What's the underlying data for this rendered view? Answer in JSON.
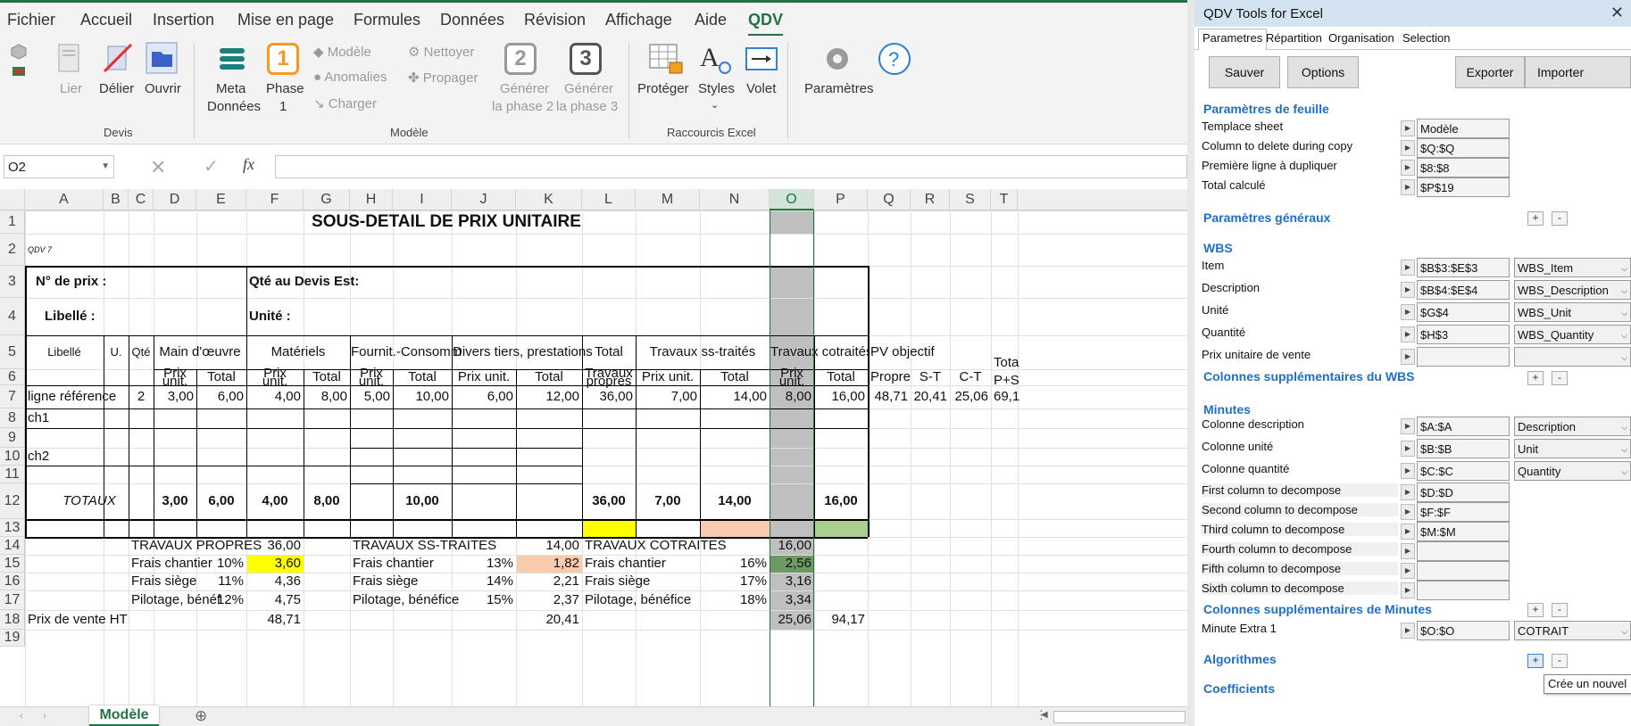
{
  "ribbon": {
    "tabs": [
      "Fichier",
      "Accueil",
      "Insertion",
      "Mise en page",
      "Formules",
      "Données",
      "Révision",
      "Affichage",
      "Aide",
      "QDV"
    ],
    "active_tab": "QDV",
    "groups": {
      "devis": "Devis",
      "modele": "Modèle",
      "raccourcis": "Raccourcis Excel"
    },
    "buttons": {
      "lier": "Lier",
      "delier": "Délier",
      "ouvrir": "Ouvrir",
      "meta1": "Meta",
      "meta2": "Données",
      "phase_l1": "Phase",
      "phase_l2": "1",
      "phase_num": "1",
      "modele": "Modèle",
      "anomalies": "Anomalies",
      "charger": "Charger",
      "nettoyer": "Nettoyer",
      "propager": "Propager",
      "gen2_num": "2",
      "gen2_l1": "Générer",
      "gen2_l2": "la phase 2",
      "gen3_num": "3",
      "gen3_l1": "Générer",
      "gen3_l2": "la phase 3",
      "proteger": "Protéger",
      "styles": "Styles",
      "volet": "Volet",
      "parametres": "Paramètres"
    }
  },
  "formula_bar": {
    "name_box": "O2",
    "formula": ""
  },
  "columns": [
    "A",
    "B",
    "C",
    "D",
    "E",
    "F",
    "G",
    "H",
    "I",
    "J",
    "K",
    "L",
    "M",
    "N",
    "O",
    "P",
    "Q",
    "R",
    "S",
    "T"
  ],
  "selected_column": "O",
  "rows": [
    "1",
    "2",
    "3",
    "4",
    "5",
    "6",
    "7",
    "8",
    "9",
    "10",
    "11",
    "12",
    "13",
    "14",
    "15",
    "16",
    "17",
    "18",
    "19"
  ],
  "sheet": {
    "title": "SOUS-DETAIL DE PRIX UNITAIRE",
    "qdv_tag": "QDV 7",
    "no_prix": "N° de prix :",
    "qte_devis": "Qté au Devis Est:",
    "libelle": "Libellé :",
    "unite_hdr": "Unité :",
    "h_main": "Main d'œuvre",
    "h_materiels": "Matériels",
    "h_fournit": "Fournit.-Consomm",
    "h_divers": "Divers tiers, prestations",
    "h_total_tp_1": "Total",
    "h_total_tp_2": "Travaux",
    "h_total_tp_3": "propres",
    "h_travaux_sst": "Travaux ss-traités",
    "h_travaux_cot": "Travaux cotraités",
    "h_pv": "PV objectif",
    "h_libelle": "Libellé",
    "h_u": "U.",
    "h_qte": "Qté",
    "h_prix": "Prix",
    "h_unit": "unit.",
    "h_total": "Total",
    "h_prix_unit": "Prix unit.",
    "h_propre": "Propre",
    "h_st": "S-T",
    "h_ct": "C-T",
    "h_tota": "Tota",
    "h_ps": "P+S",
    "r8": {
      "label": "ligne référence",
      "qte": "2",
      "d": "3,00",
      "e": "6,00",
      "f": "4,00",
      "g": "8,00",
      "h": "5,00",
      "i": "10,00",
      "j": "6,00",
      "k": "12,00",
      "l": "36,00",
      "m": "7,00",
      "n": "14,00",
      "o": "8,00",
      "p": "16,00",
      "q": "48,71",
      "r": "20,41",
      "s": "25,06",
      "t": "69,1"
    },
    "r9": "ch1",
    "r11": "ch2",
    "r13": {
      "label": "TOTAUX",
      "d": "3,00",
      "e": "6,00",
      "f": "4,00",
      "g": "8,00",
      "i": "10,00",
      "l": "36,00",
      "m": "7,00",
      "n": "14,00",
      "p": "16,00"
    },
    "recap": {
      "tp": "TRAVAUX PROPRES",
      "tp_val": "36,00",
      "sst": "TRAVAUX SS-TRAITES",
      "sst_val": "14,00",
      "cot": "TRAVAUX COTRAITES",
      "cot_val": "16,00",
      "fc": "Frais chantier",
      "fs": "Frais siège",
      "pb": "Pilotage, bénéf",
      "pb2": "Pilotage, bénéfice",
      "tp_fc_pct": "10%",
      "tp_fc": "3,60",
      "tp_fs_pct": "11%",
      "tp_fs": "4,36",
      "tp_pb_pct": "12%",
      "tp_pb": "4,75",
      "sst_fc_pct": "13%",
      "sst_fc": "1,82",
      "sst_fs_pct": "14%",
      "sst_fs": "2,21",
      "sst_pb_pct": "15%",
      "sst_pb": "2,37",
      "cot_fc_pct": "16%",
      "cot_fc": "2,56",
      "cot_fs_pct": "17%",
      "cot_fs": "3,16",
      "cot_pb_pct": "18%",
      "cot_pb": "3,34",
      "pv_ht": "Prix de vente HT",
      "pv_tp": "48,71",
      "pv_sst": "20,41",
      "pv_cot": "25,06",
      "pv_total": "94,17"
    },
    "tab_name": "Modèle"
  },
  "panel": {
    "title": "QDV Tools for Excel",
    "tabs": [
      "Parametres",
      "Répartition",
      "Organisation",
      "Selection"
    ],
    "buttons": {
      "sauver": "Sauver",
      "options": "Options",
      "exporter": "Exporter",
      "importer": "Importer"
    },
    "sections": {
      "feuille": "Paramètres de feuille",
      "generaux": "Paramètres généraux",
      "wbs": "WBS",
      "wbs_extra": "Colonnes supplémentaires du WBS",
      "minutes": "Minutes",
      "minutes_extra": "Colonnes supplémentaires de Minutes",
      "algos": "Algorithmes",
      "coefs": "Coefficients"
    },
    "feuille": [
      {
        "label": "Templace sheet",
        "value": "Modèle"
      },
      {
        "label": "Column to delete during copy",
        "value": "$Q:$Q"
      },
      {
        "label": "Première ligne à dupliquer",
        "value": "$8:$8"
      },
      {
        "label": "Total calculé",
        "value": "$P$19"
      }
    ],
    "wbs": [
      {
        "label": "Item",
        "value": "$B$3:$E$3",
        "combo": "WBS_Item"
      },
      {
        "label": "Description",
        "value": "$B$4:$E$4",
        "combo": "WBS_Description"
      },
      {
        "label": "Unité",
        "value": "$G$4",
        "combo": "WBS_Unit"
      },
      {
        "label": "Quantité",
        "value": "$H$3",
        "combo": "WBS_Quantity"
      },
      {
        "label": "Prix unitaire de vente",
        "value": "",
        "combo": ""
      }
    ],
    "minutes": [
      {
        "label": "Colonne description",
        "value": "$A:$A",
        "combo": "Description"
      },
      {
        "label": "Colonne unité",
        "value": "$B:$B",
        "combo": "Unit"
      },
      {
        "label": "Colonne quantité",
        "value": "$C:$C",
        "combo": "Quantity"
      },
      {
        "label": "First column to decompose",
        "value": "$D:$D"
      },
      {
        "label": "Second column to decompose",
        "value": "$F:$F"
      },
      {
        "label": "Third column to decompose",
        "value": "$M:$M"
      },
      {
        "label": "Fourth column to decompose",
        "value": ""
      },
      {
        "label": "Fifth column to decompose",
        "value": ""
      },
      {
        "label": "Sixth column to decompose",
        "value": ""
      }
    ],
    "minute_extra": {
      "label": "Minute Extra 1",
      "value": "$O:$O",
      "combo": "COTRAIT"
    },
    "plus": "+",
    "minus": "-",
    "tooltip": "Crée un nouvel"
  },
  "colors": {
    "excel_green": "#217346",
    "yellow": "#ffff00",
    "salmon": "#f8cbad",
    "green_fill": "#a9d08e",
    "orange": "#f4b183",
    "gray_sel": "#bfbfbf",
    "panel_blue": "#1f6fc8"
  }
}
